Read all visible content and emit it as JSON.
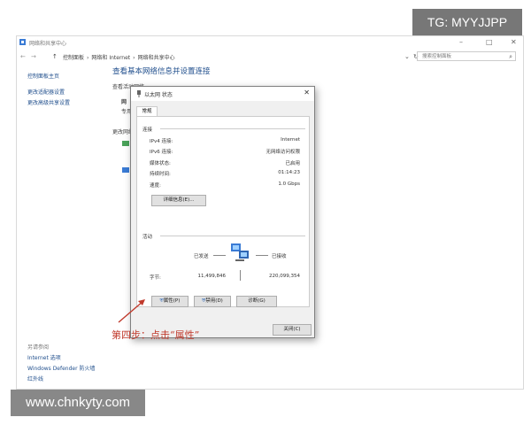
{
  "colors": {
    "accent": "#1f4e8c",
    "annotation": "#c0392b",
    "watermark_bg": "#777777"
  },
  "window": {
    "title": "网络和共享中心",
    "icon": "network-icon",
    "controls": [
      "–",
      "□",
      "✕"
    ]
  },
  "address": {
    "nav": [
      "←",
      "→",
      "↑"
    ],
    "crumbs": [
      "控制面板",
      "›",
      "网络和 Internet",
      "›",
      "网络和共享中心"
    ],
    "dropdown": "⌄",
    "refresh": "↻",
    "search_placeholder": "搜索控制面板"
  },
  "sidebar": {
    "top_items": [
      "控制面板主页",
      "更改适配器设置",
      "更改高级共享设置"
    ],
    "see_also_title": "另请参阅",
    "bottom_items": [
      "Internet 选项",
      "Windows Defender 防火墙",
      "红外线"
    ]
  },
  "main": {
    "title": "查看基本网络信息并设置连接",
    "section_active": "查看活动网络",
    "section_change": "更改网络设置",
    "partial_1": "网",
    "partial_2": "专用"
  },
  "dialog": {
    "title": "以太网 状态",
    "close": "✕",
    "tab": "常规",
    "connection_header": "连接",
    "rows": [
      {
        "label": "IPv4 连接:",
        "value": "Internet"
      },
      {
        "label": "IPv6 连接:",
        "value": "无网络访问权限"
      },
      {
        "label": "媒体状态:",
        "value": "已启用"
      },
      {
        "label": "持续时间:",
        "value": "01:14:23"
      },
      {
        "label": "速度:",
        "value": "1.0 Gbps"
      }
    ],
    "details_button": "详细信息(E)...",
    "activity_header": "活动",
    "sent_label": "已发送",
    "received_label": "已接收",
    "bytes_label": "字节:",
    "bytes_sent": "11,499,846",
    "bytes_received": "220,099,354",
    "properties_button": "属性(P)",
    "disable_button": "禁用(D)",
    "diagnose_button": "诊断(G)",
    "close_button": "关闭(C)"
  },
  "annotation": "第四步：点击“属性”",
  "watermarks": {
    "top": "TG: MYYJJPP",
    "bottom": "www.chnkyty.com"
  }
}
